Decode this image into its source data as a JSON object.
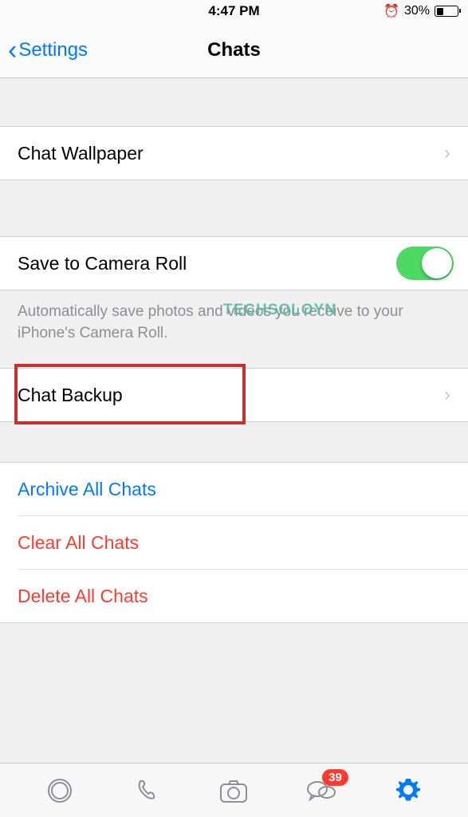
{
  "status_bar": {
    "time": "4:47 PM",
    "battery_percent": "30%"
  },
  "nav": {
    "back_label": "Settings",
    "title": "Chats"
  },
  "rows": {
    "wallpaper": "Chat Wallpaper",
    "camera_roll": "Save to Camera Roll",
    "camera_roll_toggle": true,
    "camera_roll_footer": "Automatically save photos and videos you receive to your iPhone's Camera Roll.",
    "backup": "Chat Backup"
  },
  "actions": {
    "archive": "Archive All Chats",
    "clear": "Clear All Chats",
    "delete": "Delete All Chats"
  },
  "tab_bar": {
    "chats_badge": "39"
  },
  "watermark": "TECHSOLOYN"
}
